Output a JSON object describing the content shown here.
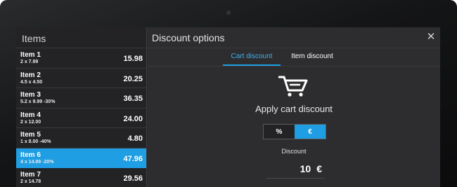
{
  "items_panel": {
    "title": "Items",
    "items": [
      {
        "name": "Item 1",
        "detail": "2 x 7.99",
        "price": "15.98",
        "selected": false
      },
      {
        "name": "Item 2",
        "detail": "4.5 x 4.50",
        "price": "20.25",
        "selected": false
      },
      {
        "name": "Item 3",
        "detail": "5.2 x 9.99 -30%",
        "price": "36.35",
        "selected": false
      },
      {
        "name": "Item 4",
        "detail": "2 x 12.00",
        "price": "24.00",
        "selected": false
      },
      {
        "name": "Item 5",
        "detail": "1 x 8.00 -40%",
        "price": "4.80",
        "selected": false
      },
      {
        "name": "Item 6",
        "detail": "4 x 14.99 -20%",
        "price": "47.96",
        "selected": true
      },
      {
        "name": "Item 7",
        "detail": "2 x 14.78",
        "price": "29.56",
        "selected": false
      }
    ]
  },
  "dialog": {
    "title": "Discount options",
    "close_icon": "close-icon",
    "tabs": [
      {
        "label": "Cart discount",
        "active": true
      },
      {
        "label": "Item discount",
        "active": false
      }
    ],
    "cart_icon": "cart-icon",
    "apply_label": "Apply cart discount",
    "toggle": {
      "options": [
        {
          "label": "%",
          "active": false
        },
        {
          "label": "€",
          "active": true
        }
      ]
    },
    "discount_label": "Discount",
    "discount_value": "10",
    "discount_unit": "€"
  },
  "colors": {
    "accent": "#1f9ee3",
    "panel_dark": "#232325",
    "panel": "#2d2d2f"
  }
}
